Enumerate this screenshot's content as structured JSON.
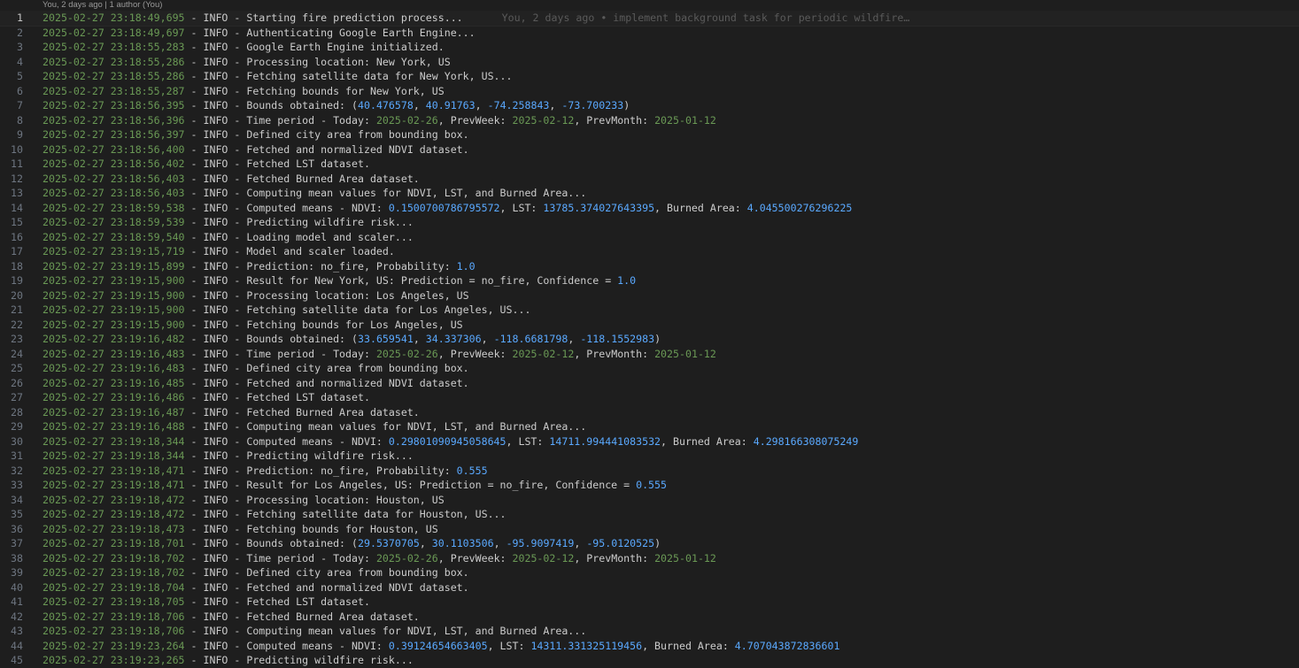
{
  "codelens": "You, 2 days ago | 1 author (You)",
  "blame": "You, 2 days ago • implement background task for periodic wildfire…",
  "colors": {
    "background": "#1e1e1e",
    "timestamp": "#6a9955",
    "number": "#5aa9ff",
    "text": "#cccccc",
    "line_number": "#6e7681"
  },
  "lines": [
    [
      {
        "t": "ts",
        "v": "2025-02-27 23:18:49,695"
      },
      {
        "t": "txt",
        "v": " - INFO - Starting fire prediction process..."
      }
    ],
    [
      {
        "t": "ts",
        "v": "2025-02-27 23:18:49,697"
      },
      {
        "t": "txt",
        "v": " - INFO - Authenticating Google Earth Engine..."
      }
    ],
    [
      {
        "t": "ts",
        "v": "2025-02-27 23:18:55,283"
      },
      {
        "t": "txt",
        "v": " - INFO - Google Earth Engine initialized."
      }
    ],
    [
      {
        "t": "ts",
        "v": "2025-02-27 23:18:55,286"
      },
      {
        "t": "txt",
        "v": " - INFO - Processing location: New York, US"
      }
    ],
    [
      {
        "t": "ts",
        "v": "2025-02-27 23:18:55,286"
      },
      {
        "t": "txt",
        "v": " - INFO - Fetching satellite data for New York, US..."
      }
    ],
    [
      {
        "t": "ts",
        "v": "2025-02-27 23:18:55,287"
      },
      {
        "t": "txt",
        "v": " - INFO - Fetching bounds for New York, US"
      }
    ],
    [
      {
        "t": "ts",
        "v": "2025-02-27 23:18:56,395"
      },
      {
        "t": "txt",
        "v": " - INFO - Bounds obtained: ("
      },
      {
        "t": "num",
        "v": "40.476578"
      },
      {
        "t": "txt",
        "v": ", "
      },
      {
        "t": "num",
        "v": "40.91763"
      },
      {
        "t": "txt",
        "v": ", "
      },
      {
        "t": "num",
        "v": "-74.258843"
      },
      {
        "t": "txt",
        "v": ", "
      },
      {
        "t": "num",
        "v": "-73.700233"
      },
      {
        "t": "txt",
        "v": ")"
      }
    ],
    [
      {
        "t": "ts",
        "v": "2025-02-27 23:18:56,396"
      },
      {
        "t": "txt",
        "v": " - INFO - Time period - Today: "
      },
      {
        "t": "dte",
        "v": "2025-02-26"
      },
      {
        "t": "txt",
        "v": ", PrevWeek: "
      },
      {
        "t": "dte",
        "v": "2025-02-12"
      },
      {
        "t": "txt",
        "v": ", PrevMonth: "
      },
      {
        "t": "dte",
        "v": "2025-01-12"
      }
    ],
    [
      {
        "t": "ts",
        "v": "2025-02-27 23:18:56,397"
      },
      {
        "t": "txt",
        "v": " - INFO - Defined city area from bounding box."
      }
    ],
    [
      {
        "t": "ts",
        "v": "2025-02-27 23:18:56,400"
      },
      {
        "t": "txt",
        "v": " - INFO - Fetched and normalized NDVI dataset."
      }
    ],
    [
      {
        "t": "ts",
        "v": "2025-02-27 23:18:56,402"
      },
      {
        "t": "txt",
        "v": " - INFO - Fetched LST dataset."
      }
    ],
    [
      {
        "t": "ts",
        "v": "2025-02-27 23:18:56,403"
      },
      {
        "t": "txt",
        "v": " - INFO - Fetched Burned Area dataset."
      }
    ],
    [
      {
        "t": "ts",
        "v": "2025-02-27 23:18:56,403"
      },
      {
        "t": "txt",
        "v": " - INFO - Computing mean values for NDVI, LST, and Burned Area..."
      }
    ],
    [
      {
        "t": "ts",
        "v": "2025-02-27 23:18:59,538"
      },
      {
        "t": "txt",
        "v": " - INFO - Computed means - NDVI: "
      },
      {
        "t": "num",
        "v": "0.1500700786795572"
      },
      {
        "t": "txt",
        "v": ", LST: "
      },
      {
        "t": "num",
        "v": "13785.374027643395"
      },
      {
        "t": "txt",
        "v": ", Burned Area: "
      },
      {
        "t": "num",
        "v": "4.045500276296225"
      }
    ],
    [
      {
        "t": "ts",
        "v": "2025-02-27 23:18:59,539"
      },
      {
        "t": "txt",
        "v": " - INFO - Predicting wildfire risk..."
      }
    ],
    [
      {
        "t": "ts",
        "v": "2025-02-27 23:18:59,540"
      },
      {
        "t": "txt",
        "v": " - INFO - Loading model and scaler..."
      }
    ],
    [
      {
        "t": "ts",
        "v": "2025-02-27 23:19:15,719"
      },
      {
        "t": "txt",
        "v": " - INFO - Model and scaler loaded."
      }
    ],
    [
      {
        "t": "ts",
        "v": "2025-02-27 23:19:15,899"
      },
      {
        "t": "txt",
        "v": " - INFO - Prediction: no_fire, Probability: "
      },
      {
        "t": "num",
        "v": "1.0"
      }
    ],
    [
      {
        "t": "ts",
        "v": "2025-02-27 23:19:15,900"
      },
      {
        "t": "txt",
        "v": " - INFO - Result for New York, US: Prediction = no_fire, Confidence = "
      },
      {
        "t": "num",
        "v": "1.0"
      }
    ],
    [
      {
        "t": "ts",
        "v": "2025-02-27 23:19:15,900"
      },
      {
        "t": "txt",
        "v": " - INFO - Processing location: Los Angeles, US"
      }
    ],
    [
      {
        "t": "ts",
        "v": "2025-02-27 23:19:15,900"
      },
      {
        "t": "txt",
        "v": " - INFO - Fetching satellite data for Los Angeles, US..."
      }
    ],
    [
      {
        "t": "ts",
        "v": "2025-02-27 23:19:15,900"
      },
      {
        "t": "txt",
        "v": " - INFO - Fetching bounds for Los Angeles, US"
      }
    ],
    [
      {
        "t": "ts",
        "v": "2025-02-27 23:19:16,482"
      },
      {
        "t": "txt",
        "v": " - INFO - Bounds obtained: ("
      },
      {
        "t": "num",
        "v": "33.659541"
      },
      {
        "t": "txt",
        "v": ", "
      },
      {
        "t": "num",
        "v": "34.337306"
      },
      {
        "t": "txt",
        "v": ", "
      },
      {
        "t": "num",
        "v": "-118.6681798"
      },
      {
        "t": "txt",
        "v": ", "
      },
      {
        "t": "num",
        "v": "-118.1552983"
      },
      {
        "t": "txt",
        "v": ")"
      }
    ],
    [
      {
        "t": "ts",
        "v": "2025-02-27 23:19:16,483"
      },
      {
        "t": "txt",
        "v": " - INFO - Time period - Today: "
      },
      {
        "t": "dte",
        "v": "2025-02-26"
      },
      {
        "t": "txt",
        "v": ", PrevWeek: "
      },
      {
        "t": "dte",
        "v": "2025-02-12"
      },
      {
        "t": "txt",
        "v": ", PrevMonth: "
      },
      {
        "t": "dte",
        "v": "2025-01-12"
      }
    ],
    [
      {
        "t": "ts",
        "v": "2025-02-27 23:19:16,483"
      },
      {
        "t": "txt",
        "v": " - INFO - Defined city area from bounding box."
      }
    ],
    [
      {
        "t": "ts",
        "v": "2025-02-27 23:19:16,485"
      },
      {
        "t": "txt",
        "v": " - INFO - Fetched and normalized NDVI dataset."
      }
    ],
    [
      {
        "t": "ts",
        "v": "2025-02-27 23:19:16,486"
      },
      {
        "t": "txt",
        "v": " - INFO - Fetched LST dataset."
      }
    ],
    [
      {
        "t": "ts",
        "v": "2025-02-27 23:19:16,487"
      },
      {
        "t": "txt",
        "v": " - INFO - Fetched Burned Area dataset."
      }
    ],
    [
      {
        "t": "ts",
        "v": "2025-02-27 23:19:16,488"
      },
      {
        "t": "txt",
        "v": " - INFO - Computing mean values for NDVI, LST, and Burned Area..."
      }
    ],
    [
      {
        "t": "ts",
        "v": "2025-02-27 23:19:18,344"
      },
      {
        "t": "txt",
        "v": " - INFO - Computed means - NDVI: "
      },
      {
        "t": "num",
        "v": "0.29801090945058645"
      },
      {
        "t": "txt",
        "v": ", LST: "
      },
      {
        "t": "num",
        "v": "14711.994441083532"
      },
      {
        "t": "txt",
        "v": ", Burned Area: "
      },
      {
        "t": "num",
        "v": "4.298166308075249"
      }
    ],
    [
      {
        "t": "ts",
        "v": "2025-02-27 23:19:18,344"
      },
      {
        "t": "txt",
        "v": " - INFO - Predicting wildfire risk..."
      }
    ],
    [
      {
        "t": "ts",
        "v": "2025-02-27 23:19:18,471"
      },
      {
        "t": "txt",
        "v": " - INFO - Prediction: no_fire, Probability: "
      },
      {
        "t": "num",
        "v": "0.555"
      }
    ],
    [
      {
        "t": "ts",
        "v": "2025-02-27 23:19:18,471"
      },
      {
        "t": "txt",
        "v": " - INFO - Result for Los Angeles, US: Prediction = no_fire, Confidence = "
      },
      {
        "t": "num",
        "v": "0.555"
      }
    ],
    [
      {
        "t": "ts",
        "v": "2025-02-27 23:19:18,472"
      },
      {
        "t": "txt",
        "v": " - INFO - Processing location: Houston, US"
      }
    ],
    [
      {
        "t": "ts",
        "v": "2025-02-27 23:19:18,472"
      },
      {
        "t": "txt",
        "v": " - INFO - Fetching satellite data for Houston, US..."
      }
    ],
    [
      {
        "t": "ts",
        "v": "2025-02-27 23:19:18,473"
      },
      {
        "t": "txt",
        "v": " - INFO - Fetching bounds for Houston, US"
      }
    ],
    [
      {
        "t": "ts",
        "v": "2025-02-27 23:19:18,701"
      },
      {
        "t": "txt",
        "v": " - INFO - Bounds obtained: ("
      },
      {
        "t": "num",
        "v": "29.5370705"
      },
      {
        "t": "txt",
        "v": ", "
      },
      {
        "t": "num",
        "v": "30.1103506"
      },
      {
        "t": "txt",
        "v": ", "
      },
      {
        "t": "num",
        "v": "-95.9097419"
      },
      {
        "t": "txt",
        "v": ", "
      },
      {
        "t": "num",
        "v": "-95.0120525"
      },
      {
        "t": "txt",
        "v": ")"
      }
    ],
    [
      {
        "t": "ts",
        "v": "2025-02-27 23:19:18,702"
      },
      {
        "t": "txt",
        "v": " - INFO - Time period - Today: "
      },
      {
        "t": "dte",
        "v": "2025-02-26"
      },
      {
        "t": "txt",
        "v": ", PrevWeek: "
      },
      {
        "t": "dte",
        "v": "2025-02-12"
      },
      {
        "t": "txt",
        "v": ", PrevMonth: "
      },
      {
        "t": "dte",
        "v": "2025-01-12"
      }
    ],
    [
      {
        "t": "ts",
        "v": "2025-02-27 23:19:18,702"
      },
      {
        "t": "txt",
        "v": " - INFO - Defined city area from bounding box."
      }
    ],
    [
      {
        "t": "ts",
        "v": "2025-02-27 23:19:18,704"
      },
      {
        "t": "txt",
        "v": " - INFO - Fetched and normalized NDVI dataset."
      }
    ],
    [
      {
        "t": "ts",
        "v": "2025-02-27 23:19:18,705"
      },
      {
        "t": "txt",
        "v": " - INFO - Fetched LST dataset."
      }
    ],
    [
      {
        "t": "ts",
        "v": "2025-02-27 23:19:18,706"
      },
      {
        "t": "txt",
        "v": " - INFO - Fetched Burned Area dataset."
      }
    ],
    [
      {
        "t": "ts",
        "v": "2025-02-27 23:19:18,706"
      },
      {
        "t": "txt",
        "v": " - INFO - Computing mean values for NDVI, LST, and Burned Area..."
      }
    ],
    [
      {
        "t": "ts",
        "v": "2025-02-27 23:19:23,264"
      },
      {
        "t": "txt",
        "v": " - INFO - Computed means - NDVI: "
      },
      {
        "t": "num",
        "v": "0.39124654663405"
      },
      {
        "t": "txt",
        "v": ", LST: "
      },
      {
        "t": "num",
        "v": "14311.331325119456"
      },
      {
        "t": "txt",
        "v": ", Burned Area: "
      },
      {
        "t": "num",
        "v": "4.707043872836601"
      }
    ],
    [
      {
        "t": "ts",
        "v": "2025-02-27 23:19:23,265"
      },
      {
        "t": "txt",
        "v": " - INFO - Predicting wildfire risk..."
      }
    ]
  ]
}
